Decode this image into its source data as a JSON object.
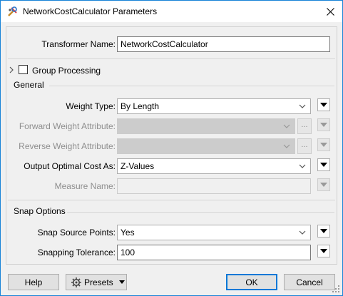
{
  "window": {
    "title": "NetworkCostCalculator Parameters",
    "accent": "#1883d7"
  },
  "transformer": {
    "label": "Transformer Name:",
    "value": "NetworkCostCalculator"
  },
  "group_processing": {
    "label": "Group Processing",
    "checked": false
  },
  "general": {
    "header": "General",
    "weight_type": {
      "label": "Weight Type:",
      "value": "By Length"
    },
    "forward_weight": {
      "label": "Forward Weight Attribute:",
      "value": "",
      "ellipsis": "..."
    },
    "reverse_weight": {
      "label": "Reverse Weight Attribute:",
      "value": "",
      "ellipsis": "..."
    },
    "output_cost": {
      "label": "Output Optimal Cost As:",
      "value": "Z-Values"
    },
    "measure_name": {
      "label": "Measure Name:",
      "value": ""
    }
  },
  "snap": {
    "header": "Snap Options",
    "snap_source": {
      "label": "Snap Source Points:",
      "value": "Yes"
    },
    "tolerance": {
      "label": "Snapping Tolerance:",
      "value": "100"
    }
  },
  "buttons": {
    "help": "Help",
    "presets": "Presets",
    "ok": "OK",
    "cancel": "Cancel"
  },
  "icons": {
    "app": "fme-transformer-icon",
    "close": "close-icon",
    "chevron": "chevron-down-icon",
    "expand": "chevron-right-icon",
    "menu": "triangle-down-icon",
    "presets": "gear-icon"
  }
}
